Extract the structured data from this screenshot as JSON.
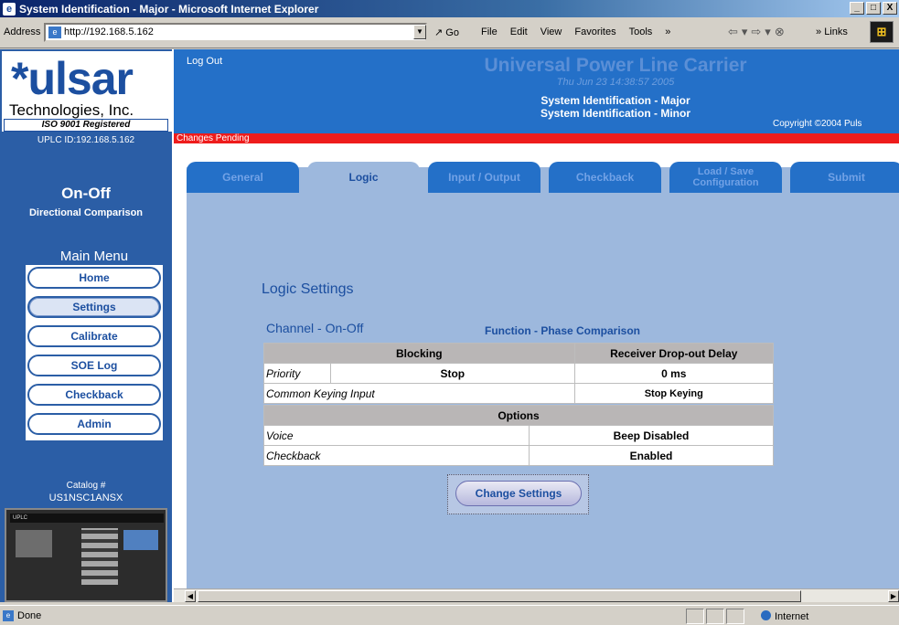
{
  "window": {
    "title": "System Identification - Major - Microsoft Internet Explorer",
    "buttons": [
      "_",
      "□",
      "X"
    ]
  },
  "toolbar": {
    "address_label": "Address",
    "url": "http://192.168.5.162",
    "go_label": "Go",
    "menu": [
      "File",
      "Edit",
      "View",
      "Favorites",
      "Tools"
    ],
    "links_label": "Links"
  },
  "sidebar": {
    "logo_text": "*ulsar",
    "company": "Technologies, Inc.",
    "iso": "ISO 9001 Registered",
    "uplc_id": "UPLC ID:192.168.5.162",
    "mode_title": "On-Off",
    "mode_subtitle": "Directional Comparison",
    "menu_title": "Main Menu",
    "menu_items": [
      {
        "label": "Home",
        "active": false
      },
      {
        "label": "Settings",
        "active": true
      },
      {
        "label": "Calibrate",
        "active": false
      },
      {
        "label": "SOE Log",
        "active": false
      },
      {
        "label": "Checkback",
        "active": false
      },
      {
        "label": "Admin",
        "active": false
      }
    ],
    "catalog_label": "Catalog #",
    "catalog_number": "US1NSC1ANSX",
    "device_label": "UPLC"
  },
  "header": {
    "logout": "Log Out",
    "title": "Universal Power Line Carrier",
    "datetime": "Thu Jun 23 14:38:57 2005",
    "system_major": "System Identification - Major",
    "system_minor": "System Identification - Minor",
    "copyright": "Copyright ©2004 Puls"
  },
  "pending_text": "Changes Pending",
  "tabs": [
    {
      "label": "General",
      "active": false
    },
    {
      "label": "Logic",
      "active": true
    },
    {
      "label": "Input / Output",
      "active": false
    },
    {
      "label": "Checkback",
      "active": false
    },
    {
      "label": "Load / Save Configuration",
      "active": false
    },
    {
      "label": "Submit",
      "active": false
    }
  ],
  "logic": {
    "section_title": "Logic Settings",
    "channel": "Channel - On-Off",
    "function": "Function - Phase Comparison",
    "blocking_header": "Blocking",
    "dropout_header": "Receiver Drop-out Delay",
    "priority_label": "Priority",
    "priority_value": "Stop",
    "dropout_value": "0 ms",
    "keying_label": "Common Keying Input",
    "keying_value": "Stop Keying",
    "options_header": "Options",
    "voice_label": "Voice",
    "voice_value": "Beep Disabled",
    "checkback_label": "Checkback",
    "checkback_value": "Enabled",
    "change_button": "Change Settings"
  },
  "status": {
    "text": "Done",
    "zone": "Internet"
  }
}
